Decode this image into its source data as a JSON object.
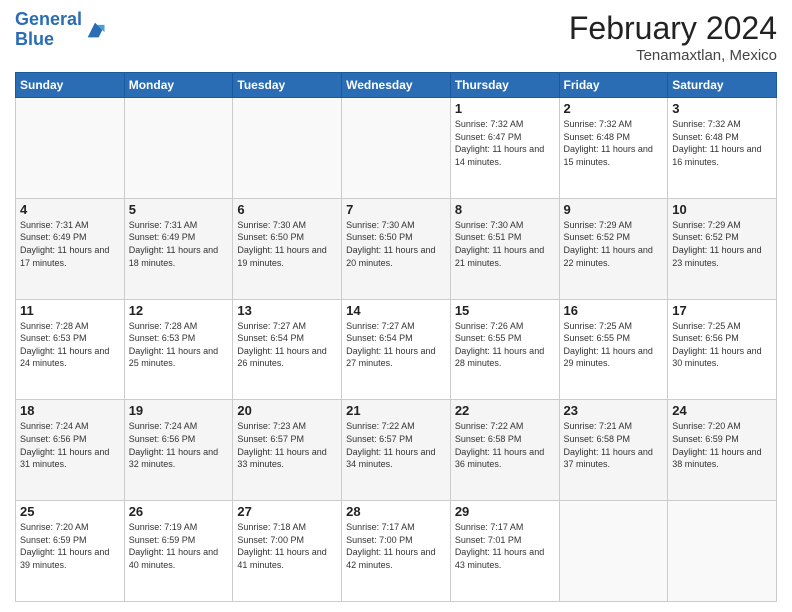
{
  "logo": {
    "line1": "General",
    "line2": "Blue"
  },
  "title": "February 2024",
  "subtitle": "Tenamaxtlan, Mexico",
  "days_of_week": [
    "Sunday",
    "Monday",
    "Tuesday",
    "Wednesday",
    "Thursday",
    "Friday",
    "Saturday"
  ],
  "weeks": [
    [
      {
        "day": "",
        "info": ""
      },
      {
        "day": "",
        "info": ""
      },
      {
        "day": "",
        "info": ""
      },
      {
        "day": "",
        "info": ""
      },
      {
        "day": "1",
        "info": "Sunrise: 7:32 AM\nSunset: 6:47 PM\nDaylight: 11 hours and 14 minutes."
      },
      {
        "day": "2",
        "info": "Sunrise: 7:32 AM\nSunset: 6:48 PM\nDaylight: 11 hours and 15 minutes."
      },
      {
        "day": "3",
        "info": "Sunrise: 7:32 AM\nSunset: 6:48 PM\nDaylight: 11 hours and 16 minutes."
      }
    ],
    [
      {
        "day": "4",
        "info": "Sunrise: 7:31 AM\nSunset: 6:49 PM\nDaylight: 11 hours and 17 minutes."
      },
      {
        "day": "5",
        "info": "Sunrise: 7:31 AM\nSunset: 6:49 PM\nDaylight: 11 hours and 18 minutes."
      },
      {
        "day": "6",
        "info": "Sunrise: 7:30 AM\nSunset: 6:50 PM\nDaylight: 11 hours and 19 minutes."
      },
      {
        "day": "7",
        "info": "Sunrise: 7:30 AM\nSunset: 6:50 PM\nDaylight: 11 hours and 20 minutes."
      },
      {
        "day": "8",
        "info": "Sunrise: 7:30 AM\nSunset: 6:51 PM\nDaylight: 11 hours and 21 minutes."
      },
      {
        "day": "9",
        "info": "Sunrise: 7:29 AM\nSunset: 6:52 PM\nDaylight: 11 hours and 22 minutes."
      },
      {
        "day": "10",
        "info": "Sunrise: 7:29 AM\nSunset: 6:52 PM\nDaylight: 11 hours and 23 minutes."
      }
    ],
    [
      {
        "day": "11",
        "info": "Sunrise: 7:28 AM\nSunset: 6:53 PM\nDaylight: 11 hours and 24 minutes."
      },
      {
        "day": "12",
        "info": "Sunrise: 7:28 AM\nSunset: 6:53 PM\nDaylight: 11 hours and 25 minutes."
      },
      {
        "day": "13",
        "info": "Sunrise: 7:27 AM\nSunset: 6:54 PM\nDaylight: 11 hours and 26 minutes."
      },
      {
        "day": "14",
        "info": "Sunrise: 7:27 AM\nSunset: 6:54 PM\nDaylight: 11 hours and 27 minutes."
      },
      {
        "day": "15",
        "info": "Sunrise: 7:26 AM\nSunset: 6:55 PM\nDaylight: 11 hours and 28 minutes."
      },
      {
        "day": "16",
        "info": "Sunrise: 7:25 AM\nSunset: 6:55 PM\nDaylight: 11 hours and 29 minutes."
      },
      {
        "day": "17",
        "info": "Sunrise: 7:25 AM\nSunset: 6:56 PM\nDaylight: 11 hours and 30 minutes."
      }
    ],
    [
      {
        "day": "18",
        "info": "Sunrise: 7:24 AM\nSunset: 6:56 PM\nDaylight: 11 hours and 31 minutes."
      },
      {
        "day": "19",
        "info": "Sunrise: 7:24 AM\nSunset: 6:56 PM\nDaylight: 11 hours and 32 minutes."
      },
      {
        "day": "20",
        "info": "Sunrise: 7:23 AM\nSunset: 6:57 PM\nDaylight: 11 hours and 33 minutes."
      },
      {
        "day": "21",
        "info": "Sunrise: 7:22 AM\nSunset: 6:57 PM\nDaylight: 11 hours and 34 minutes."
      },
      {
        "day": "22",
        "info": "Sunrise: 7:22 AM\nSunset: 6:58 PM\nDaylight: 11 hours and 36 minutes."
      },
      {
        "day": "23",
        "info": "Sunrise: 7:21 AM\nSunset: 6:58 PM\nDaylight: 11 hours and 37 minutes."
      },
      {
        "day": "24",
        "info": "Sunrise: 7:20 AM\nSunset: 6:59 PM\nDaylight: 11 hours and 38 minutes."
      }
    ],
    [
      {
        "day": "25",
        "info": "Sunrise: 7:20 AM\nSunset: 6:59 PM\nDaylight: 11 hours and 39 minutes."
      },
      {
        "day": "26",
        "info": "Sunrise: 7:19 AM\nSunset: 6:59 PM\nDaylight: 11 hours and 40 minutes."
      },
      {
        "day": "27",
        "info": "Sunrise: 7:18 AM\nSunset: 7:00 PM\nDaylight: 11 hours and 41 minutes."
      },
      {
        "day": "28",
        "info": "Sunrise: 7:17 AM\nSunset: 7:00 PM\nDaylight: 11 hours and 42 minutes."
      },
      {
        "day": "29",
        "info": "Sunrise: 7:17 AM\nSunset: 7:01 PM\nDaylight: 11 hours and 43 minutes."
      },
      {
        "day": "",
        "info": ""
      },
      {
        "day": "",
        "info": ""
      }
    ]
  ]
}
